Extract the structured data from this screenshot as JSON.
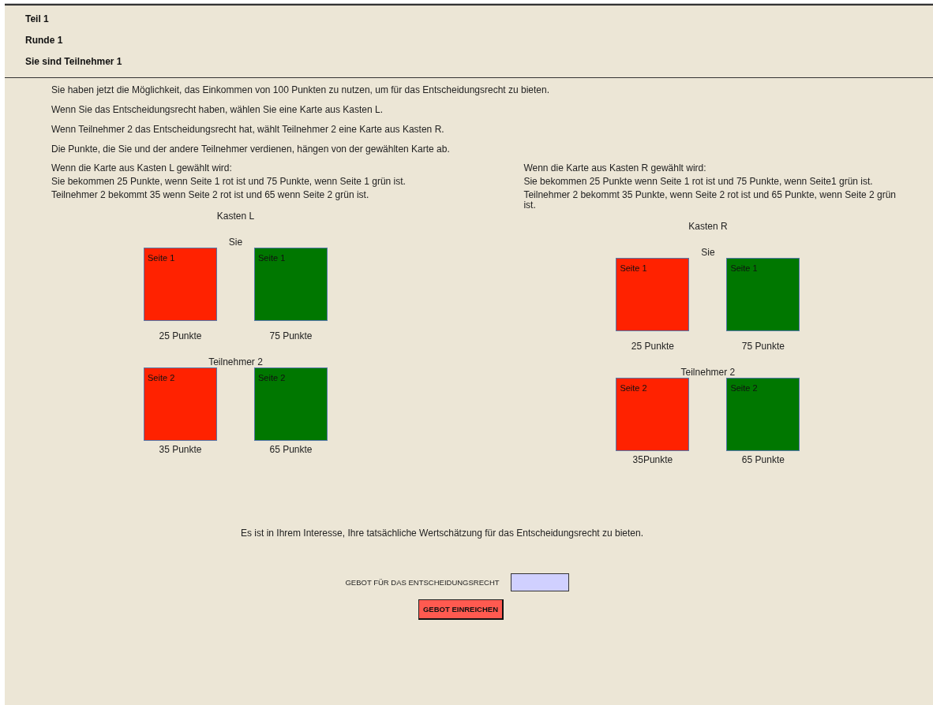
{
  "header": [
    "Teil 1",
    "Runde 1",
    "Sie sind Teilnehmer 1"
  ],
  "intro": [
    "Sie haben jetzt die Möglichkeit, das Einkommen von 100 Punkten zu nutzen, um für das Entscheidungsrecht zu bieten.",
    "Wenn Sie das Entscheidungsrecht haben, wählen Sie eine Karte aus Kasten L.",
    "Wenn Teilnehmer 2 das Entscheidungsrecht hat, wählt Teilnehmer 2 eine Karte aus Kasten R.",
    "Die Punkte, die Sie und der andere Teilnehmer verdienen, hängen von der gewählten Karte ab."
  ],
  "boxes": [
    {
      "condition": "Wenn die Karte aus Kasten L gewählt wird:",
      "lines": [
        "Sie bekommen 25 Punkte, wenn Seite 1 rot ist und 75 Punkte, wenn Seite 1 grün ist.",
        "Teilnehmer 2 bekommt 35 wenn Seite 2 rot ist und 65 wenn Seite 2 grün ist."
      ],
      "title": "Kasten L",
      "groups": [
        {
          "label": "Sie",
          "cards": [
            {
              "label": "Seite 1",
              "color": "#ff2200",
              "points": "25 Punkte"
            },
            {
              "label": "Seite 1",
              "color": "#007700",
              "points": "75 Punkte"
            }
          ]
        },
        {
          "label": "Teilnehmer 2",
          "cards": [
            {
              "label": "Seite 2",
              "color": "#ff2200",
              "points": "35 Punkte"
            },
            {
              "label": "Seite 2",
              "color": "#007700",
              "points": "65 Punkte"
            }
          ]
        }
      ]
    },
    {
      "condition": "Wenn die Karte aus Kasten R gewählt wird:",
      "lines": [
        "Sie bekommen 25 Punkte wenn Seite 1 rot ist und 75 Punkte, wenn Seite1 grün ist.",
        "Teilnehmer 2 bekommt 35 Punkte, wenn Seite 2 rot ist und 65 Punkte, wenn Seite 2 grün ist."
      ],
      "title": "Kasten R",
      "groups": [
        {
          "label": "Sie",
          "cards": [
            {
              "label": "Seite 1",
              "color": "#ff2200",
              "points": "25 Punkte"
            },
            {
              "label": "Seite 1",
              "color": "#007700",
              "points": "75 Punkte"
            }
          ]
        },
        {
          "label": "Teilnehmer 2",
          "cards": [
            {
              "label": "Seite 2",
              "color": "#ff2200",
              "points": "35Punkte"
            },
            {
              "label": "Seite 2",
              "color": "#007700",
              "points": "65 Punkte"
            }
          ]
        }
      ]
    }
  ],
  "note": "Es ist in Ihrem Interesse, Ihre tatsächliche Wertschätzung für das Entscheidungsrecht zu bieten.",
  "bid": {
    "label": "GEBOT FÜR DAS ENTSCHEIDUNGSRECHT"
  },
  "submit": "GEBOT EINREICHEN"
}
